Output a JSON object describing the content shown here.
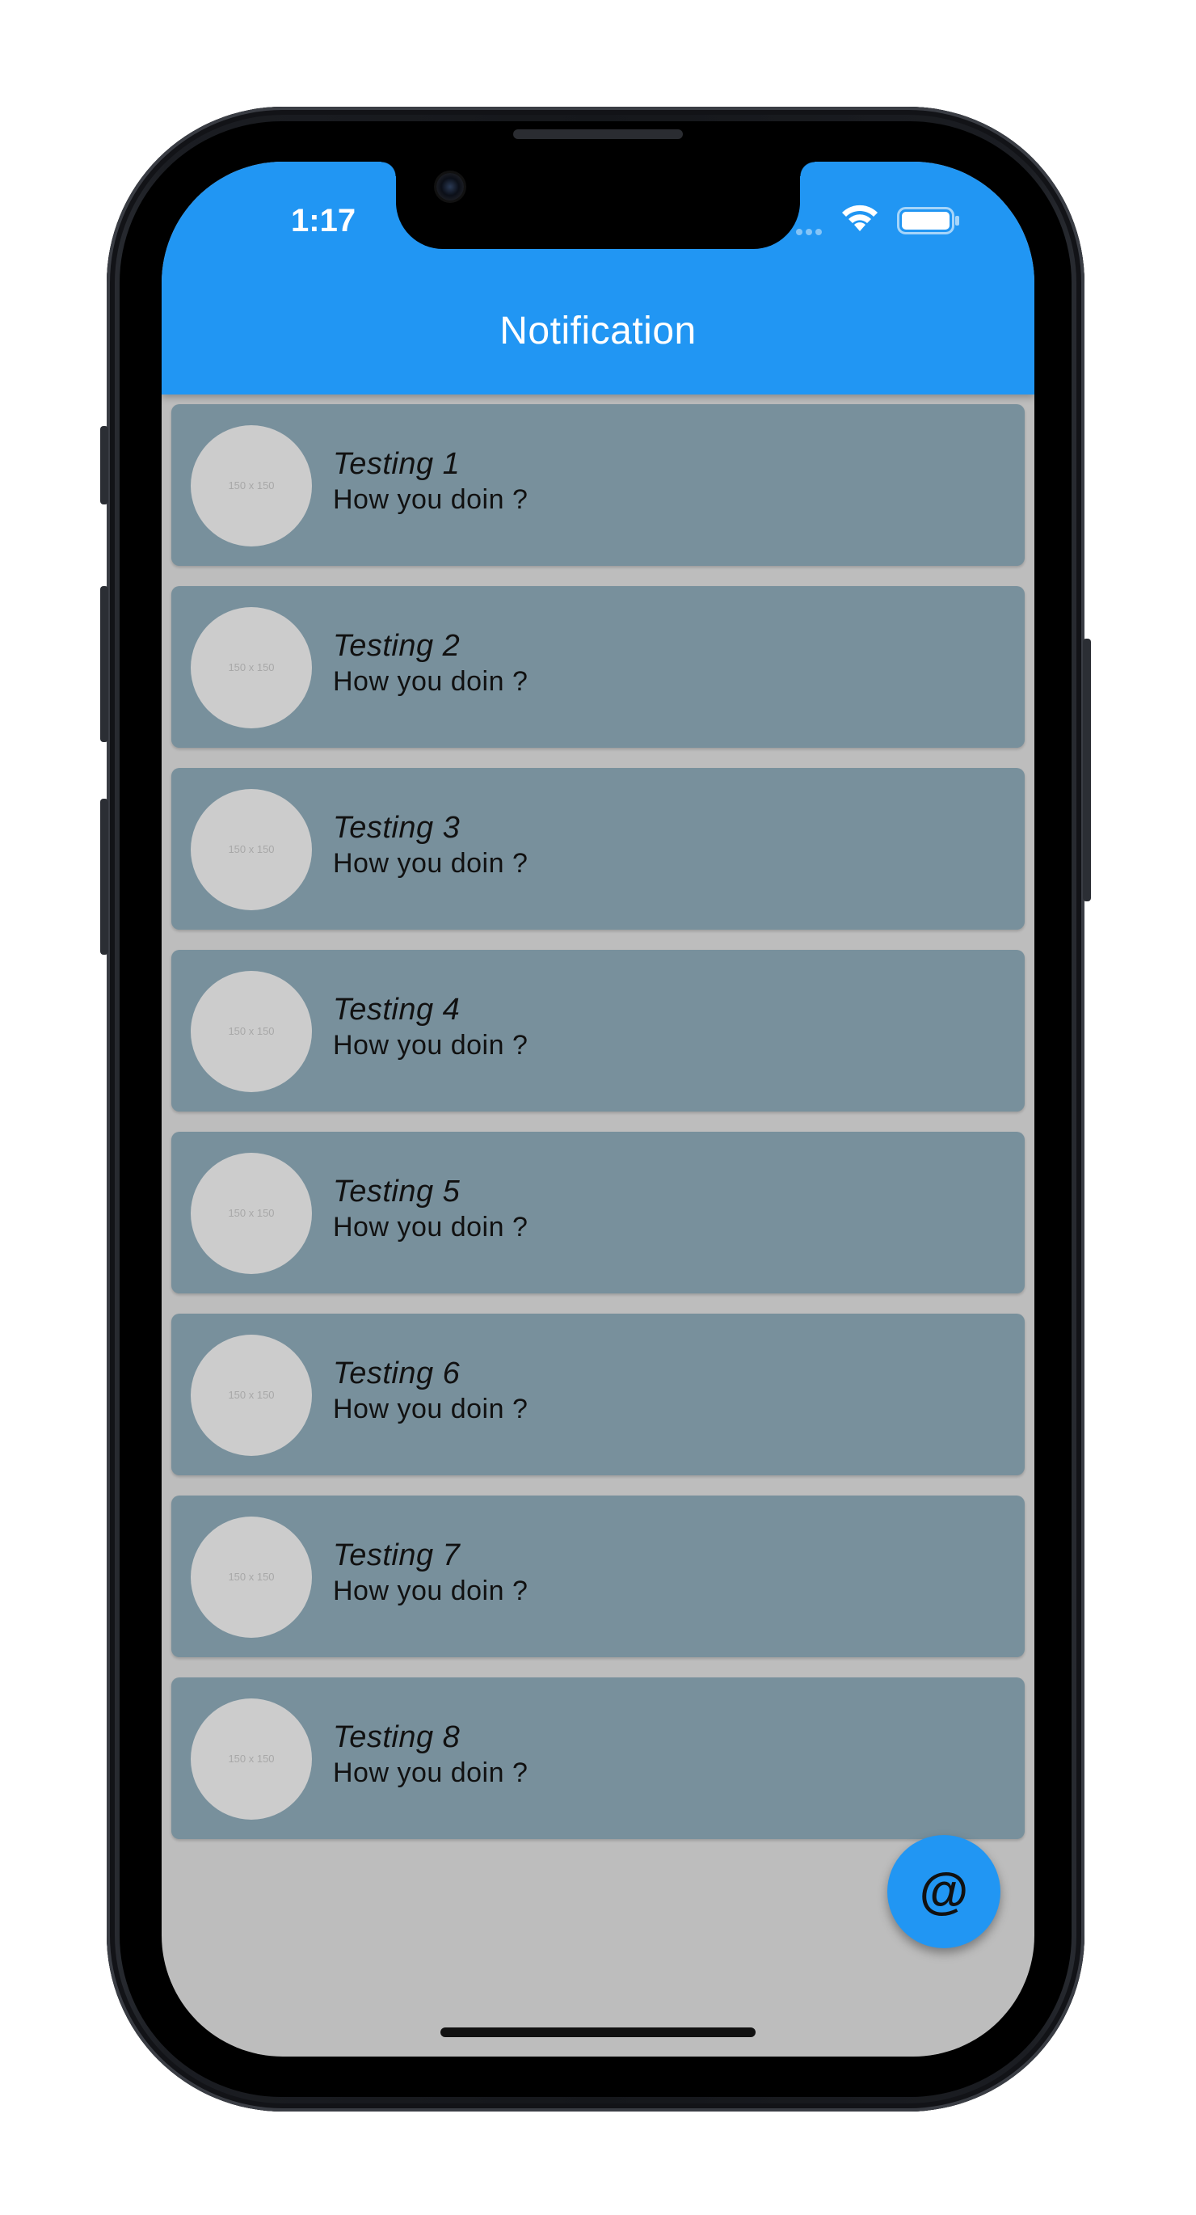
{
  "status_bar": {
    "time": "1:17"
  },
  "app_bar": {
    "title": "Notification",
    "color": "#2196f3"
  },
  "notifications": [
    {
      "title": "Testing 1",
      "subtitle": "How you doin ?",
      "avatar_placeholder": "150 x 150"
    },
    {
      "title": "Testing 2",
      "subtitle": "How you doin ?",
      "avatar_placeholder": "150 x 150"
    },
    {
      "title": "Testing 3",
      "subtitle": "How you doin ?",
      "avatar_placeholder": "150 x 150"
    },
    {
      "title": "Testing 4",
      "subtitle": "How you doin ?",
      "avatar_placeholder": "150 x 150"
    },
    {
      "title": "Testing 5",
      "subtitle": "How you doin ?",
      "avatar_placeholder": "150 x 150"
    },
    {
      "title": "Testing 6",
      "subtitle": "How you doin ?",
      "avatar_placeholder": "150 x 150"
    },
    {
      "title": "Testing 7",
      "subtitle": "How you doin ?",
      "avatar_placeholder": "150 x 150"
    },
    {
      "title": "Testing 8",
      "subtitle": "How you doin ?",
      "avatar_placeholder": "150 x 150"
    }
  ],
  "fab": {
    "label": "@",
    "icon": "at-sign-icon"
  },
  "colors": {
    "card": "#78909c",
    "background": "#bdbdbd",
    "avatar": "#cccccc"
  }
}
